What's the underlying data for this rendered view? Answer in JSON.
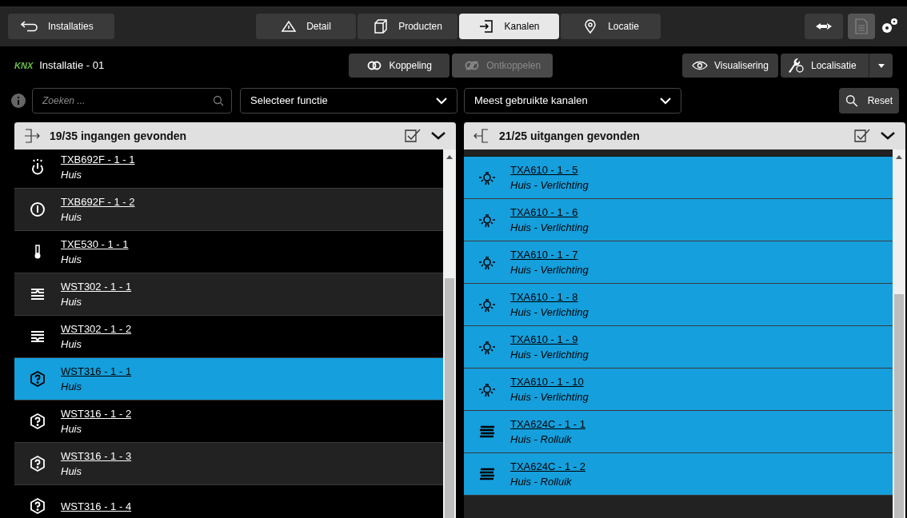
{
  "top_bar": {
    "back": "Installaties",
    "tabs": [
      {
        "label": "Detail",
        "kind": "detail",
        "selected": false
      },
      {
        "label": "Producten",
        "kind": "box",
        "selected": false
      },
      {
        "label": "Kanalen",
        "kind": "channels",
        "selected": true
      },
      {
        "label": "Locatie",
        "kind": "pin",
        "selected": false
      }
    ]
  },
  "toolbar": {
    "logo": "KNX",
    "installation": "Installatie - 01",
    "actions": [
      {
        "label": "Koppeling",
        "kind": "link",
        "disabled": false
      },
      {
        "label": "Ontkoppelen",
        "kind": "unlink",
        "disabled": true
      }
    ],
    "visualisation": "Visualisering",
    "localisation": "Localisatie"
  },
  "filters": {
    "search": {
      "placeholder": "Zoeken ..."
    },
    "function_select": "Selecteer functie",
    "channel_select": "Meest gebruikte kanalen",
    "reset": "Reset"
  },
  "panels": [
    {
      "kind": "inputs",
      "title": "19/35 ingangen gevonden",
      "items": [
        {
          "name": "TXB692F - 1 - 1",
          "location": "Huis",
          "kind": "touch",
          "selected": false
        },
        {
          "name": "TXB692F - 1 - 2",
          "location": "Huis",
          "kind": "power",
          "selected": false
        },
        {
          "name": "TXE530 - 1 - 1",
          "location": "Huis",
          "kind": "thermometer",
          "selected": false
        },
        {
          "name": "WST302 - 1 - 1",
          "location": "Huis",
          "kind": "wind-up",
          "selected": false
        },
        {
          "name": "WST302 - 1 - 2",
          "location": "Huis",
          "kind": "wind-down",
          "selected": false
        },
        {
          "name": "WST316 - 1 - 1",
          "location": "Huis",
          "kind": "unknown",
          "selected": true
        },
        {
          "name": "WST316 - 1 - 2",
          "location": "Huis",
          "kind": "unknown",
          "selected": false
        },
        {
          "name": "WST316 - 1 - 3",
          "location": "Huis",
          "kind": "unknown",
          "selected": false
        },
        {
          "name": "WST316 - 1 - 4",
          "kind": "unknown",
          "selected": false
        }
      ]
    },
    {
      "kind": "outputs",
      "title": "21/25 uitgangen gevonden",
      "items": [
        {
          "name": "TXA610 - 1 - 5",
          "location": "Huis - Verlichting",
          "kind": "bulb",
          "selected": true
        },
        {
          "name": "TXA610 - 1 - 6",
          "location": "Huis - Verlichting",
          "kind": "bulb",
          "selected": true
        },
        {
          "name": "TXA610 - 1 - 7",
          "location": "Huis - Verlichting",
          "kind": "bulb",
          "selected": true
        },
        {
          "name": "TXA610 - 1 - 8",
          "location": "Huis - Verlichting",
          "kind": "bulb",
          "selected": true
        },
        {
          "name": "TXA610 - 1 - 9",
          "location": "Huis - Verlichting",
          "kind": "bulb",
          "selected": true
        },
        {
          "name": "TXA610 - 1 - 10",
          "location": "Huis - Verlichting",
          "kind": "bulb",
          "selected": true
        },
        {
          "name": "TXA624C - 1 - 1",
          "location": "Huis - Rolluik",
          "kind": "blinds",
          "selected": true
        },
        {
          "name": "TXA624C - 1 - 2",
          "location": "Huis - Rolluik",
          "kind": "blinds",
          "selected": true
        }
      ]
    }
  ]
}
